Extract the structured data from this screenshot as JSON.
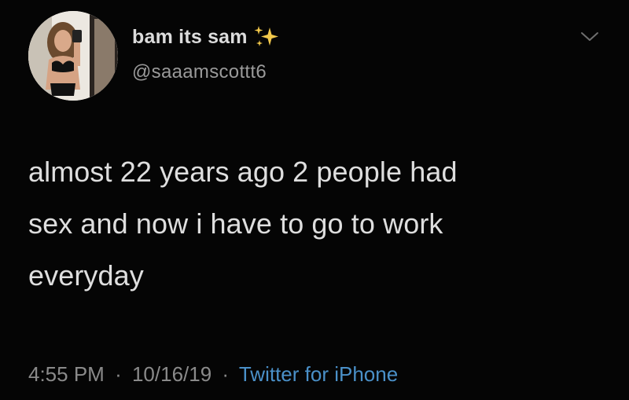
{
  "tweet": {
    "display_name": "bam its sam",
    "handle": "@saaamscottt6",
    "text": "almost 22 years ago 2 people had\nsex and now i have to go to work\neveryday",
    "time": "4:55 PM",
    "separator": "·",
    "date": "10/16/19",
    "source": "Twitter for iPhone"
  },
  "icons": {
    "name_emoji": "sparkles-icon",
    "menu": "chevron-down-icon",
    "avatar": "profile-photo"
  },
  "colors": {
    "background": "#050505",
    "name": "#dcdcdc",
    "handle": "#9a9a9a",
    "body_text": "#dedede",
    "meta": "#8a8a8a",
    "source_link": "#4a90c8",
    "sparkle": "#f2c84b"
  }
}
